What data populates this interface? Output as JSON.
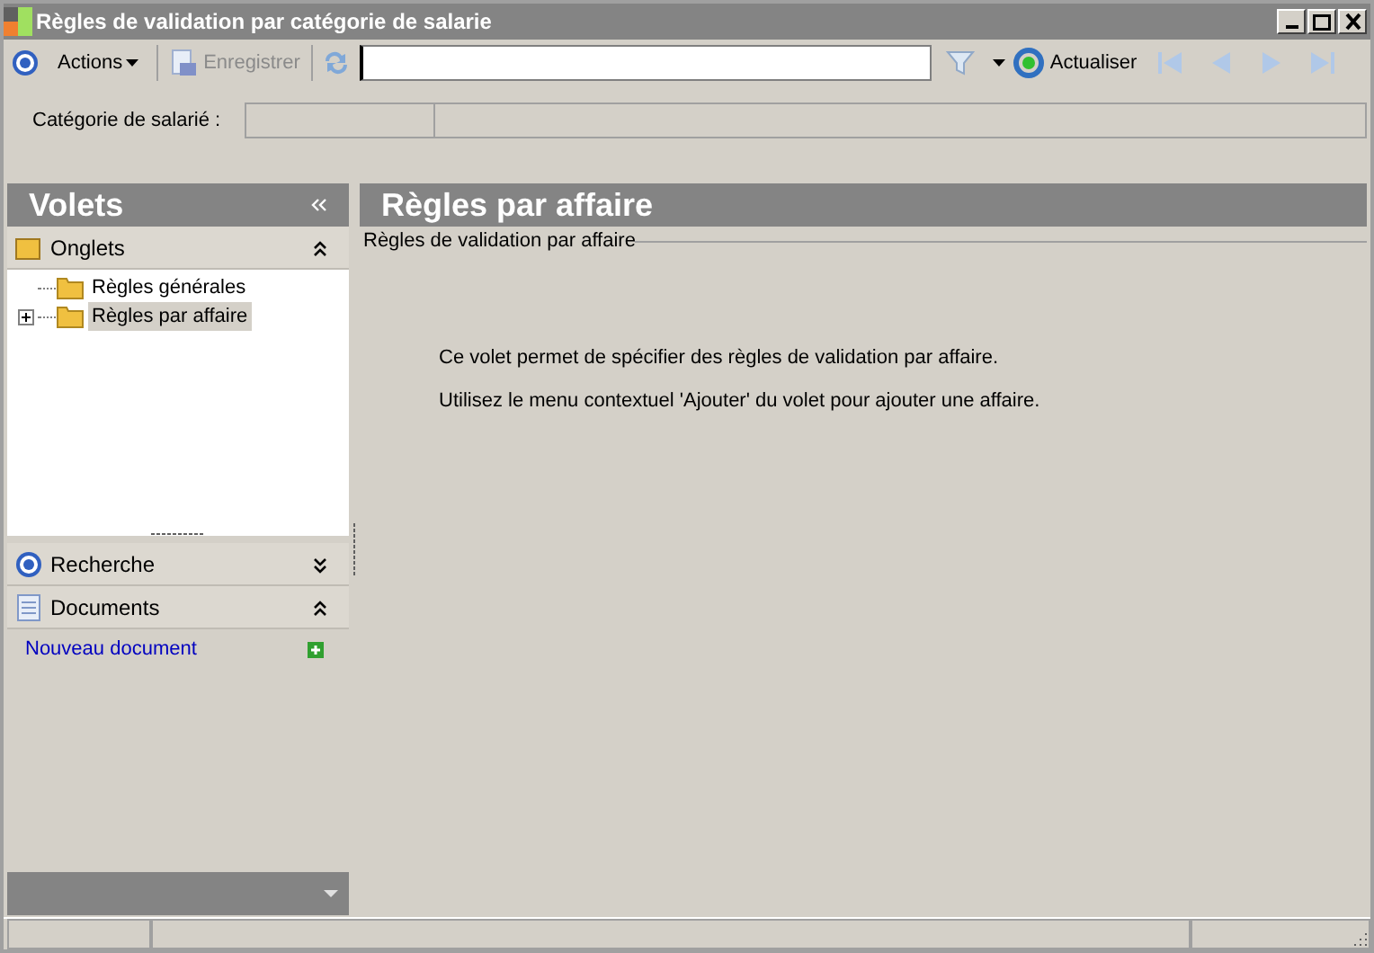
{
  "window": {
    "title": "Règles de validation par catégorie de salarie"
  },
  "toolbar": {
    "actions": "Actions",
    "save": {
      "label": "Enregistrer",
      "disabled": true
    },
    "refresh": "Actualiser"
  },
  "category": {
    "label": "Catégorie de salarié :"
  },
  "sidebar": {
    "title": "Volets",
    "sections": [
      {
        "title": "Onglets",
        "kind": "tree",
        "expanded": true,
        "tree": [
          {
            "label": "Règles générales",
            "selected": false,
            "expandable": false
          },
          {
            "label": "Règles par affaire",
            "selected": true,
            "expandable": true
          }
        ]
      },
      {
        "title": "Recherche",
        "kind": "search",
        "expanded": false
      },
      {
        "title": "Documents",
        "kind": "documents",
        "expanded": true,
        "links": [
          "Nouveau document"
        ]
      }
    ]
  },
  "content": {
    "title": "Règles par affaire",
    "group": "Règles de validation par affaire",
    "paragraphs": [
      "Ce volet permet de spécifier des règles de validation par affaire.",
      "Utilisez le menu contextuel 'Ajouter' du volet pour ajouter une affaire."
    ]
  }
}
